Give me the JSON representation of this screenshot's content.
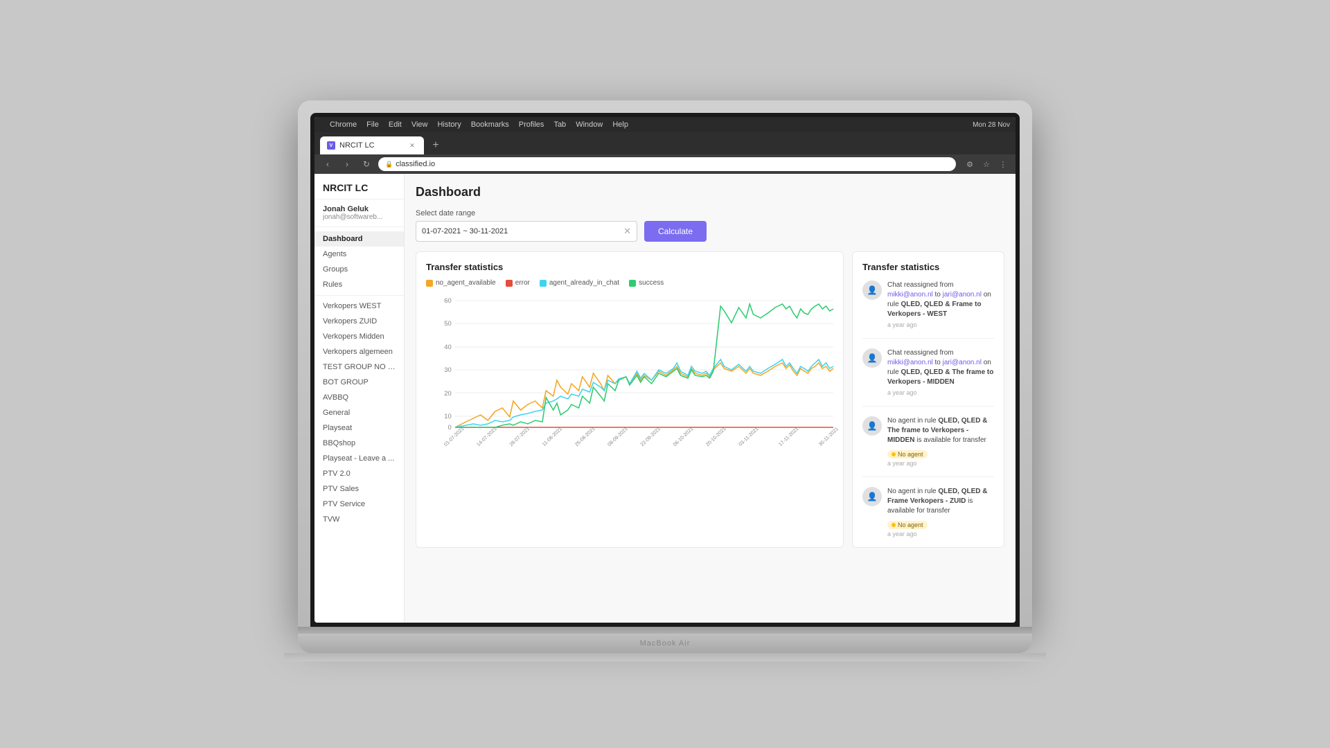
{
  "os": {
    "menubar": [
      "",
      "File",
      "Edit",
      "View",
      "History",
      "Bookmarks",
      "Profiles",
      "Tab",
      "Window",
      "Help"
    ],
    "datetime": "Mon 28 Nov",
    "browser_name": "Chrome"
  },
  "browser": {
    "tab_title": "NRCIT LC",
    "url": "classified.io",
    "new_tab_label": "+"
  },
  "app": {
    "logo": "NRCIT LC",
    "user": {
      "name": "Jonah Geluk",
      "email": "jonah@softwareb..."
    },
    "nav": [
      {
        "label": "Dashboard",
        "active": true
      },
      {
        "label": "Agents",
        "active": false
      },
      {
        "label": "Groups",
        "active": false
      },
      {
        "label": "Rules",
        "active": false
      }
    ],
    "sidebar_groups": [
      "Verkopers WEST",
      "Verkopers ZUID",
      "Verkopers Midden",
      "Verkopers algemeen",
      "TEST GROUP NO C...",
      "BOT GROUP",
      "AVBBQ",
      "General",
      "Playseat",
      "BBQshop",
      "Playseat - Leave a ...",
      "PTV 2.0",
      "PTV Sales",
      "PTV Service",
      "TVW"
    ]
  },
  "dashboard": {
    "title": "Dashboard",
    "date_range_label": "Select date range",
    "date_range_value": "01-07-2021 ~ 30-11-2021",
    "calculate_label": "Calculate",
    "chart": {
      "title": "Transfer statistics",
      "legend": [
        {
          "label": "no_agent_available",
          "color": "#f5a623"
        },
        {
          "label": "error",
          "color": "#e74c3c"
        },
        {
          "label": "agent_already_in_chat",
          "color": "#3dd4f0"
        },
        {
          "label": "success",
          "color": "#2ecc71"
        }
      ],
      "y_labels": [
        "0",
        "10",
        "20",
        "30",
        "40",
        "50",
        "60"
      ],
      "x_labels": [
        "01-07-2021",
        "14-07-2021",
        "28-07-2021",
        "11-08-2021",
        "25-08-2021",
        "08-09-2021",
        "22-09-2021",
        "06-10-2021",
        "20-10-2021",
        "03-11-2021",
        "17-11-2021",
        "30-11-2021"
      ]
    },
    "transfer_stats_title": "Transfer statistics",
    "stats": [
      {
        "from": "mikki@anon.nl",
        "to": "jari@anon.nl",
        "rule": "QLED, QLED & Frame to Verkopers - WEST",
        "time": "a year ago",
        "type": "reassigned"
      },
      {
        "from": "mikki@anon.nl",
        "to": "jari@anon.nl",
        "rule": "QLED, QLED & The frame to Verkopers - MIDDEN",
        "time": "a year ago",
        "type": "reassigned"
      },
      {
        "rule": "QLED, QLED & The frame to Verkopers - MIDDEN",
        "time": "a year ago",
        "type": "no_agent",
        "badge": "No agent"
      },
      {
        "rule": "QLED, QLED & Frame Verkopers - ZUID",
        "time": "a year ago",
        "type": "no_agent",
        "badge": "No agent"
      }
    ]
  }
}
